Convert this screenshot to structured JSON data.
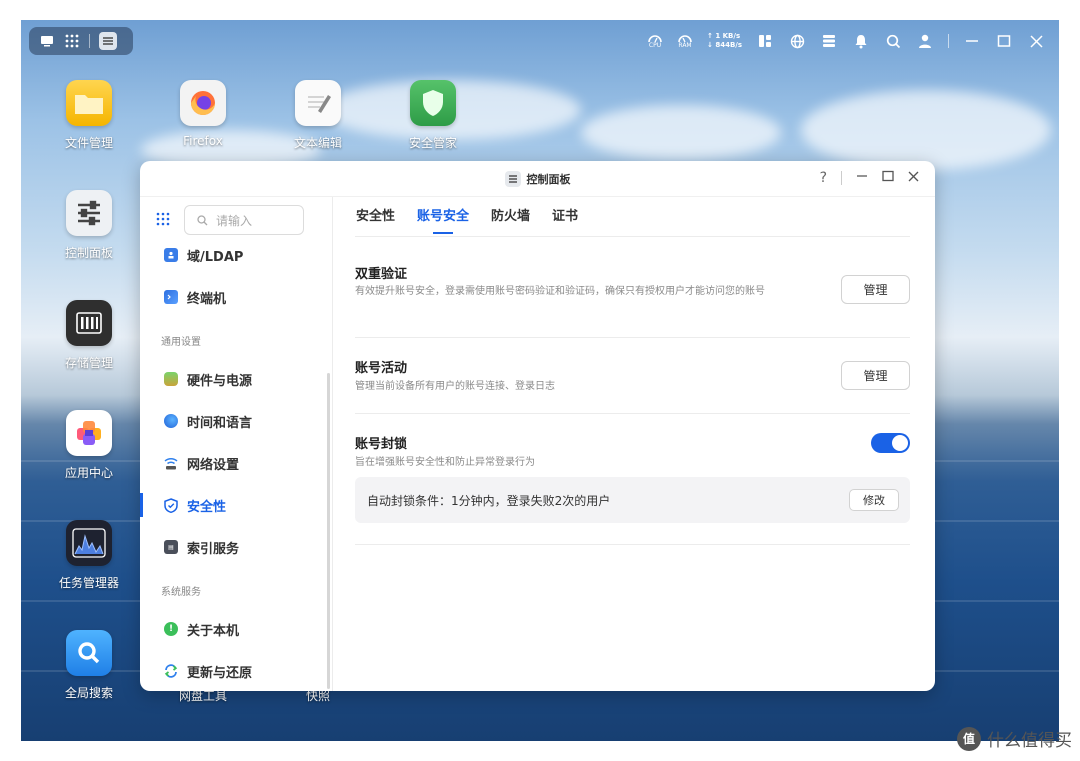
{
  "desktop": {
    "icons": [
      {
        "label": "文件管理"
      },
      {
        "label": "Firefox"
      },
      {
        "label": "文本编辑"
      },
      {
        "label": "安全管家"
      },
      {
        "label": "控制面板"
      },
      {
        "label": "存储管理"
      },
      {
        "label": "应用中心"
      },
      {
        "label": "任务管理器"
      },
      {
        "label": "全局搜索"
      },
      {
        "label": "网盘工具"
      },
      {
        "label": "快照"
      }
    ]
  },
  "topbar": {
    "cpu_label": "CPU",
    "ram_label": "RAM",
    "net_up": "1 KB/s",
    "net_down": "844B/s"
  },
  "window": {
    "title": "控制面板",
    "help": "?"
  },
  "sidebar": {
    "search_placeholder": "请输入",
    "items_top": [
      {
        "label": "域/LDAP"
      },
      {
        "label": "终端机"
      }
    ],
    "group_general": "通用设置",
    "items_general": [
      {
        "label": "硬件与电源"
      },
      {
        "label": "时间和语言"
      },
      {
        "label": "网络设置"
      },
      {
        "label": "安全性",
        "active": true
      },
      {
        "label": "索引服务"
      }
    ],
    "group_system": "系统服务",
    "items_system": [
      {
        "label": "关于本机"
      },
      {
        "label": "更新与还原"
      }
    ]
  },
  "tabs": [
    {
      "label": "安全性"
    },
    {
      "label": "账号安全",
      "active": true
    },
    {
      "label": "防火墙"
    },
    {
      "label": "证书"
    }
  ],
  "sections": {
    "two_factor": {
      "title": "双重验证",
      "desc": "有效提升账号安全，登录需使用账号密码验证和验证码，确保只有授权用户才能访问您的账号",
      "button": "管理"
    },
    "activity": {
      "title": "账号活动",
      "desc": "管理当前设备所有用户的账号连接、登录日志",
      "button": "管理"
    },
    "lockout": {
      "title": "账号封锁",
      "desc": "旨在增强账号安全性和防止异常登录行为",
      "enabled": true,
      "rule": "自动封锁条件：1分钟内，登录失败2次的用户",
      "rule_button": "修改"
    }
  },
  "watermark": {
    "logo": "值",
    "text": "什么值得买"
  },
  "colors": {
    "accent": "#1a62e6"
  }
}
